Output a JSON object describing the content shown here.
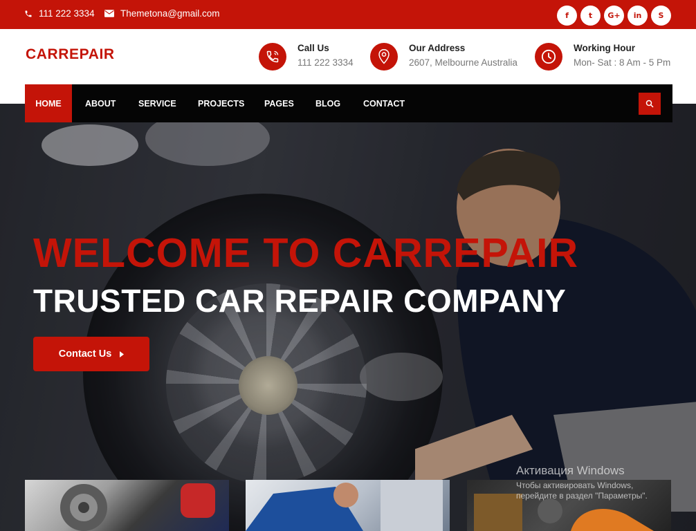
{
  "topbar": {
    "phone": "111 222 3334",
    "email": "Themetona@gmail.com",
    "social": [
      "f",
      "t",
      "G+",
      "in",
      "S"
    ]
  },
  "header": {
    "logo": "CARREPAIR",
    "info": [
      {
        "title": "Call Us",
        "value": "111 222 3334",
        "icon": "phone-icon"
      },
      {
        "title": "Our Address",
        "value": "2607, Melbourne Australia",
        "icon": "map-pin-icon"
      },
      {
        "title": "Working Hour",
        "value": "Mon- Sat : 8 Am - 5 Pm",
        "icon": "clock-icon"
      }
    ]
  },
  "nav": {
    "items": [
      "HOME",
      "ABOUT",
      "SERVICE",
      "PROJECTS",
      "PAGES",
      "BLOG",
      "CONTACT"
    ],
    "active": "HOME"
  },
  "hero": {
    "title": "WELCOME TO CARREPAIR",
    "subtitle": "TRUSTED CAR REPAIR COMPANY",
    "cta_label": "Contact Us"
  },
  "watermark": {
    "line1": "Активация Windows",
    "line2": "Чтобы активировать Windows,",
    "line3": "перейдите в раздел \"Параметры\"."
  },
  "colors": {
    "accent": "#c41408",
    "nav_bg": "#050505"
  }
}
